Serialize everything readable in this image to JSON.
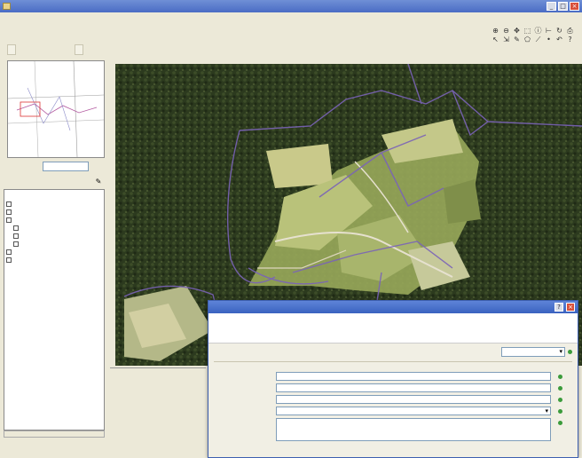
{
  "window": {
    "title": "",
    "buttons": [
      "_",
      "□",
      "×"
    ]
  },
  "menu": [
    "",
    "",
    "",
    "",
    ""
  ],
  "toolbar": {
    "path_text": "",
    "buttons": [
      "",
      ""
    ]
  },
  "icons": [
    "magnifier-plus-icon",
    "magnifier-minus-icon",
    "pan-icon",
    "select-icon",
    "info-icon",
    "measure-icon",
    "refresh-icon",
    "print-icon",
    "arrow-icon",
    "move-icon",
    "edit-icon",
    "polygon-icon",
    "line-icon",
    "point-icon",
    "undo-icon",
    "help-icon"
  ],
  "sidebar": {
    "zoom_label": "",
    "zoom_value": "",
    "layers_label": "",
    "tree": [
      {
        "text": "",
        "red": true
      },
      {
        "text": "",
        "red": false
      },
      {
        "text": "",
        "red": false
      },
      {
        "text": "",
        "red": false
      },
      {
        "text": "",
        "red": false
      },
      {
        "text": "",
        "red": false
      },
      {
        "text": "",
        "red": false
      },
      {
        "text": "",
        "red": false
      },
      {
        "text": "",
        "red": false
      }
    ],
    "status": ""
  },
  "coords": {
    "line1": "",
    "line2": "",
    "line3": ""
  },
  "dialog": {
    "title": "",
    "header": "",
    "logo": "",
    "subtitle": "",
    "select_value": "",
    "fields": [
      {
        "label": "",
        "value": ""
      },
      {
        "label": "",
        "value": ""
      },
      {
        "label": "",
        "value": ""
      },
      {
        "label": "",
        "value": ""
      },
      {
        "label": "",
        "value": ""
      }
    ],
    "footer": ""
  },
  "colors": {
    "titlebar": "#4a6cc4",
    "boundary": "#7a63b8",
    "ok": "#3b9b3b"
  }
}
